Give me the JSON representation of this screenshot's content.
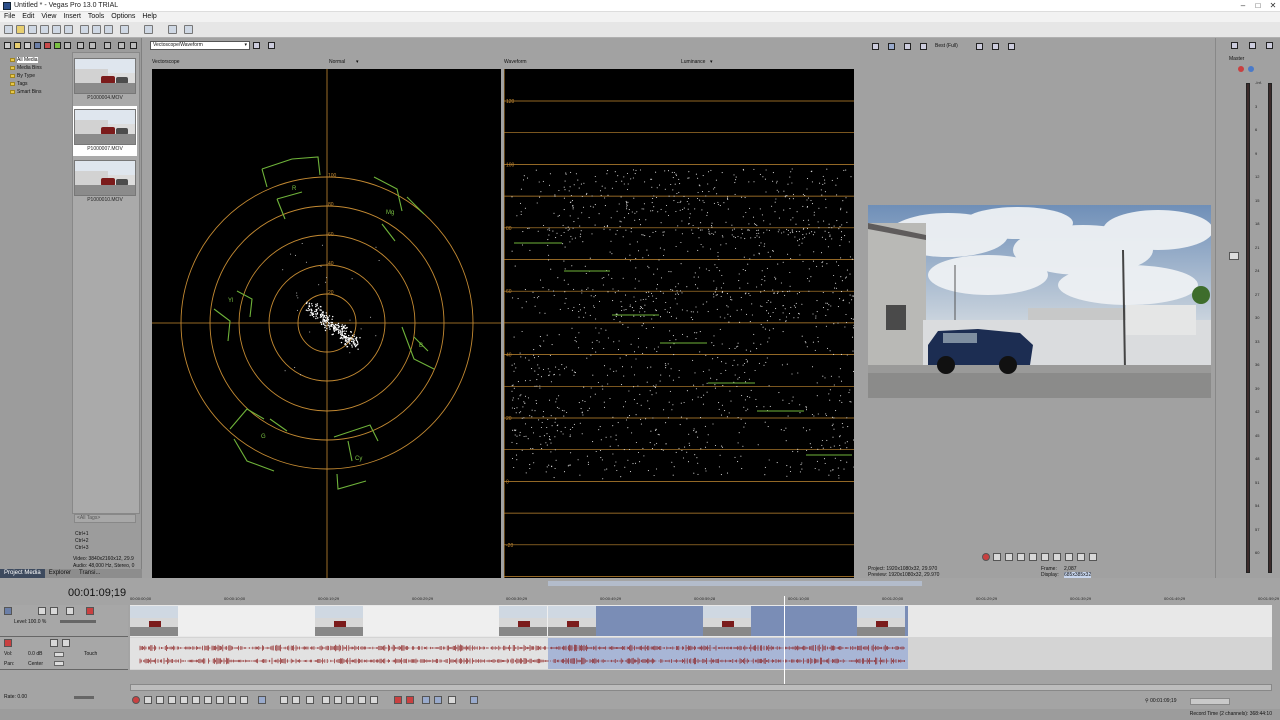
{
  "window": {
    "title": "Untitled * - Vegas Pro 13.0 TRIAL"
  },
  "menu": [
    "File",
    "Edit",
    "View",
    "Insert",
    "Tools",
    "Options",
    "Help"
  ],
  "explorer": {
    "tree": [
      "All Media",
      "Media Bins",
      "By Type",
      "Tags",
      "Smart Bins"
    ],
    "selected_index": 0,
    "media": [
      "P1000004.MOV",
      "P1000007.MOV",
      "P1000010.MOV"
    ],
    "selected_media_index": 1,
    "search_placeholder": "<All Tags>",
    "shortcuts": [
      "Ctrl+1",
      "Ctrl+2",
      "Ctrl+3"
    ],
    "info_video": "Video: 3840x2160x12, 29.9",
    "info_audio": "Audio: 48,000 Hz, Stereo, 0",
    "tabs": [
      "Project Media",
      "Explorer",
      "Transi..."
    ]
  },
  "scopes": {
    "mode": "Vectoscope/Waveform",
    "vector_label": "Vectorscope",
    "vector_mode": "Normal",
    "wave_label": "Waveform",
    "wave_mode": "Luminance",
    "vector_targets": [
      "R",
      "Mg",
      "B",
      "Cy",
      "G",
      "Yl"
    ],
    "vector_rings": [
      "100",
      "80",
      "60",
      "40",
      "20"
    ],
    "wave_scale": [
      "120",
      "100",
      "80",
      "60",
      "40",
      "20",
      "0",
      "-20"
    ]
  },
  "preview": {
    "quality": "Best (Full)",
    "project": "Project:   1920x1080x32, 29.970",
    "previewres": "Preview:   1920x1080x32, 29.970",
    "frame_label": "Frame:",
    "frame": "2,087",
    "display_label": "Display:",
    "display": "685x385x32"
  },
  "mixer": {
    "label": "Master",
    "scale": [
      "-Inf.",
      "3",
      "6",
      "9",
      "12",
      "15",
      "18",
      "21",
      "24",
      "27",
      "30",
      "33",
      "36",
      "39",
      "42",
      "45",
      "48",
      "51",
      "54",
      "57",
      "60"
    ]
  },
  "timeline": {
    "timecode": "00:01:09;19",
    "ruler": [
      "00:00:00;00",
      "00:00:10;00",
      "00:00:19;29",
      "00:00:29;29",
      "00:00:39;29",
      "00:00:49;29",
      "00:00:59;28",
      "00:01:10;00",
      "00:01:20;00",
      "00:01:29;29",
      "00:01:39;29",
      "00:01:49;29",
      "00:01:59;29"
    ],
    "video_track": {
      "level_label": "Level:",
      "level": "100.0 %"
    },
    "audio_track": {
      "vol_label": "Vol:",
      "vol": "0.0 dB",
      "pan_label": "Pan:",
      "pan": "Center",
      "mode": "Touch"
    },
    "rate": "Rate: 0.00",
    "cursor_time": "00:01:09;19",
    "record_time": "Record Time (2 channels): 368:44:10"
  },
  "colors": {
    "accent": "#3d4a5e",
    "scope_orange": "#d79a38",
    "scope_green": "#7ac143"
  }
}
